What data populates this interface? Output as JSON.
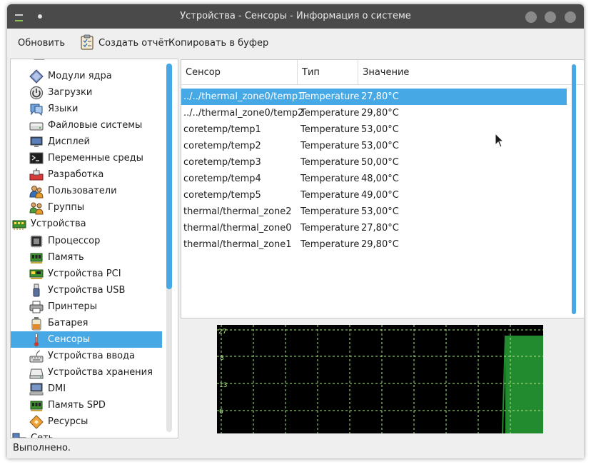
{
  "window": {
    "title": "Устройства - Сенсоры - Информация о системе"
  },
  "toolbar": {
    "refresh": "Обновить",
    "report": "Создать отчёт",
    "copy": "Копировать в буфер"
  },
  "sidebar": {
    "items": [
      {
        "label": "Модули ядра",
        "icon": "kernel-modules-icon"
      },
      {
        "label": "Загрузки",
        "icon": "boot-icon"
      },
      {
        "label": "Языки",
        "icon": "languages-icon"
      },
      {
        "label": "Файловые системы",
        "icon": "filesystems-icon"
      },
      {
        "label": "Дисплей",
        "icon": "display-icon"
      },
      {
        "label": "Переменные среды",
        "icon": "terminal-icon"
      },
      {
        "label": "Разработка",
        "icon": "development-icon"
      },
      {
        "label": "Пользователи",
        "icon": "users-icon"
      },
      {
        "label": "Группы",
        "icon": "groups-icon"
      },
      {
        "label": "Устройства",
        "icon": "devices-icon"
      },
      {
        "label": "Процессор",
        "icon": "cpu-icon"
      },
      {
        "label": "Память",
        "icon": "memory-icon"
      },
      {
        "label": "Устройства PCI",
        "icon": "pci-icon"
      },
      {
        "label": "Устройства USB",
        "icon": "usb-icon"
      },
      {
        "label": "Принтеры",
        "icon": "printer-icon"
      },
      {
        "label": "Батарея",
        "icon": "battery-icon"
      },
      {
        "label": "Сенсоры",
        "icon": "thermometer-icon"
      },
      {
        "label": "Устройства ввода",
        "icon": "input-devices-icon"
      },
      {
        "label": "Устройства хранения",
        "icon": "storage-icon"
      },
      {
        "label": "DMI",
        "icon": "dmi-icon"
      },
      {
        "label": "Память SPD",
        "icon": "spd-icon"
      },
      {
        "label": "Ресурсы",
        "icon": "resources-icon"
      },
      {
        "label": "Сеть",
        "icon": "network-icon"
      }
    ]
  },
  "table": {
    "columns": [
      "Сенсор",
      "Тип",
      "Значение"
    ],
    "rows": [
      [
        "../../thermal_zone0/temp1",
        "Temperature",
        "27,80°C"
      ],
      [
        "../../thermal_zone0/temp2",
        "Temperature",
        "29,80°C"
      ],
      [
        "coretemp/temp1",
        "Temperature",
        "53,00°C"
      ],
      [
        "coretemp/temp2",
        "Temperature",
        "53,00°C"
      ],
      [
        "coretemp/temp3",
        "Temperature",
        "50,00°C"
      ],
      [
        "coretemp/temp4",
        "Temperature",
        "48,00°C"
      ],
      [
        "coretemp/temp5",
        "Temperature",
        "49,00°C"
      ],
      [
        "thermal/thermal_zone2",
        "Temperature",
        "53,00°C"
      ],
      [
        "thermal/thermal_zone0",
        "Temperature",
        "27,80°C"
      ],
      [
        "thermal/thermal_zone1",
        "Temperature",
        "29,80°C"
      ]
    ]
  },
  "graph": {
    "labels": [
      "27",
      "8",
      "13",
      "6"
    ],
    "colors": {
      "background": "#000000",
      "grid": "#aee88a",
      "fill": "#228b2f"
    }
  },
  "status": {
    "text": "Выполнено."
  }
}
